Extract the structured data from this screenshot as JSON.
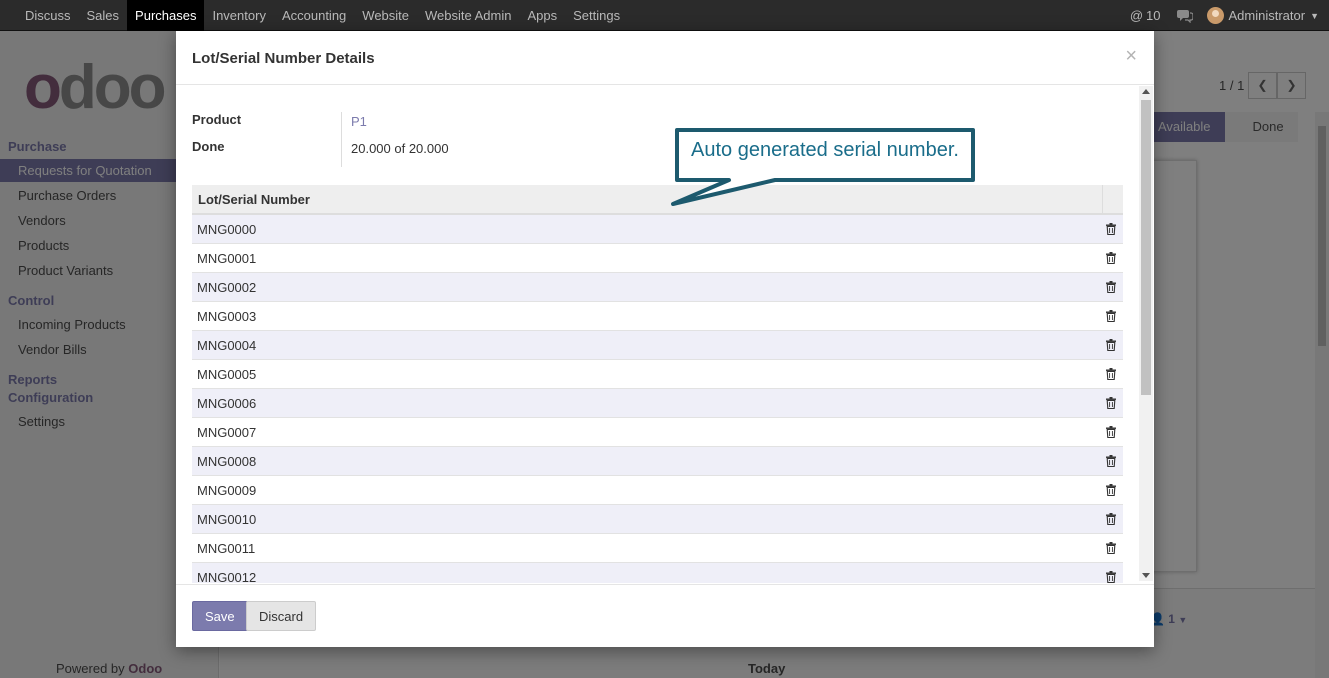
{
  "navbar": {
    "menu": [
      "Discuss",
      "Sales",
      "Purchases",
      "Inventory",
      "Accounting",
      "Website",
      "Website Admin",
      "Apps",
      "Settings"
    ],
    "active": "Purchases",
    "messages_count": "10",
    "user_name": "Administrator"
  },
  "sidebar": {
    "purchase_title": "Purchase",
    "purchase_items": [
      "Requests for Quotation",
      "Purchase Orders",
      "Vendors",
      "Products",
      "Product Variants"
    ],
    "control_title": "Control",
    "control_items": [
      "Incoming Products",
      "Vendor Bills"
    ],
    "reports_title": "Reports",
    "config_title": "Configuration",
    "config_items": [
      "Settings"
    ],
    "powered_by": "Powered by",
    "powered_brand": "Odoo"
  },
  "background": {
    "pager": "1 / 1",
    "status_available": "Available",
    "status_done": "Done",
    "followers": "1",
    "today": "Today"
  },
  "modal": {
    "title": "Lot/Serial Number Details",
    "close": "×",
    "product_label": "Product",
    "product_value": "P1",
    "done_label": "Done",
    "done_value": "20.000 of 20.000",
    "column_header": "Lot/Serial Number",
    "lots": [
      "MNG0000",
      "MNG0001",
      "MNG0002",
      "MNG0003",
      "MNG0004",
      "MNG0005",
      "MNG0006",
      "MNG0007",
      "MNG0008",
      "MNG0009",
      "MNG0010",
      "MNG0011",
      "MNG0012"
    ],
    "save_label": "Save",
    "discard_label": "Discard"
  },
  "annotation": {
    "text": "Auto generated serial number."
  },
  "colors": {
    "accent": "#7c7bad",
    "brand": "#875a7b",
    "callout_border": "#1d5a6e"
  }
}
